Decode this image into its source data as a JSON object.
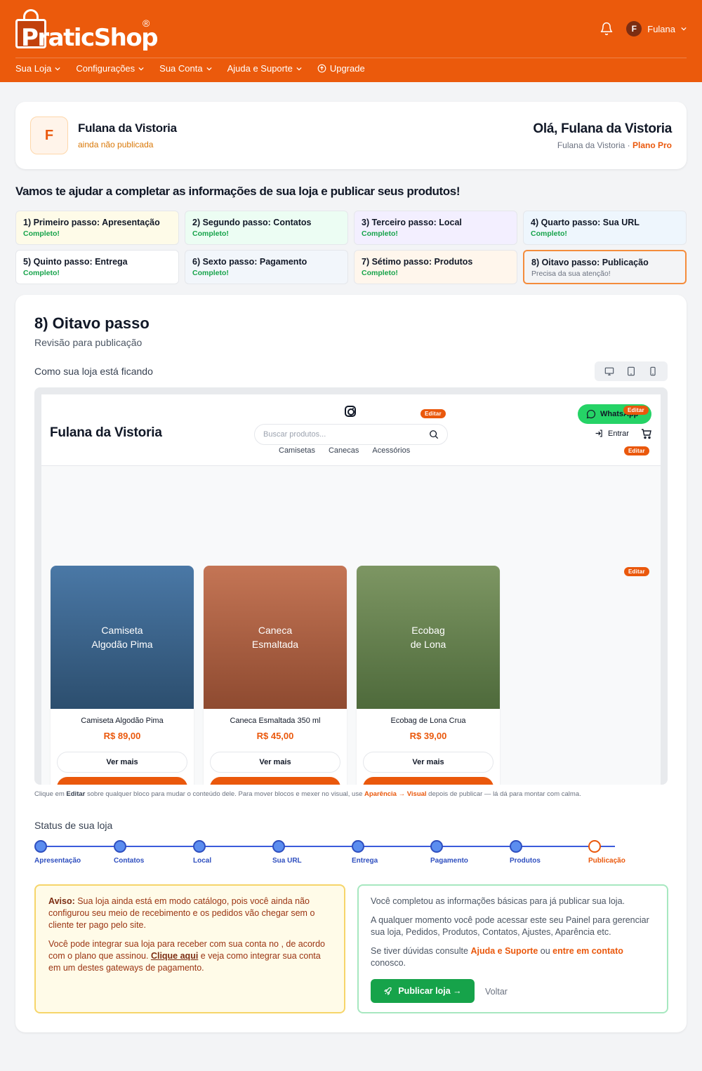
{
  "brand": {
    "name": "PraticShop",
    "reg": "®",
    "color": "#eb5a0c"
  },
  "header": {
    "user": {
      "initial": "F",
      "name": "Fulana"
    },
    "nav": [
      "Sua Loja",
      "Configurações",
      "Sua Conta",
      "Ajuda e Suporte",
      "Upgrade"
    ]
  },
  "profile": {
    "initial": "F",
    "name": "Fulana da Vistoria",
    "status": "ainda não publicada",
    "greeting": "Olá, Fulana da Vistoria",
    "subtitle": "Fulana da Vistoria · ",
    "plan": "Plano Pro"
  },
  "help_title": "Vamos te ajudar a completar as informações de sua loja e publicar seus produtos!",
  "steps": [
    {
      "title": "1) Primeiro passo: Apresentação",
      "status": "Completo!"
    },
    {
      "title": "2) Segundo passo: Contatos",
      "status": "Completo!"
    },
    {
      "title": "3) Terceiro passo: Local",
      "status": "Completo!"
    },
    {
      "title": "4) Quarto passo: Sua URL",
      "status": "Completo!"
    },
    {
      "title": "5) Quinto passo: Entrega",
      "status": "Completo!"
    },
    {
      "title": "6) Sexto passo: Pagamento",
      "status": "Completo!"
    },
    {
      "title": "7) Sétimo passo: Produtos",
      "status": "Completo!"
    },
    {
      "title": "8) Oitavo passo: Publicação",
      "status": "Precisa da sua atenção!"
    }
  ],
  "main": {
    "title": "8) Oitavo passo",
    "subtitle": "Revisão para publicação",
    "preview_label": "Como sua loja está ficando"
  },
  "preview": {
    "store_name": "Fulana da Vistoria",
    "search_placeholder": "Buscar produtos...",
    "categories": [
      "Camisetas",
      "Canecas",
      "Acessórios"
    ],
    "whatsapp": "WhatsApp",
    "login": "Entrar",
    "edit_label": "Editar",
    "products": [
      {
        "img_line1": "Camiseta",
        "img_line2": "Algodão Pima",
        "name": "Camiseta Algodão Pima",
        "price": "R$ 89,00",
        "button": "Ver mais",
        "color_top": "#4a78a6",
        "color_bottom": "#2c4e6e"
      },
      {
        "img_line1": "Caneca",
        "img_line2": "Esmaltada",
        "name": "Caneca Esmaltada 350 ml",
        "price": "R$ 45,00",
        "button": "Ver mais",
        "color_top": "#c47555",
        "color_bottom": "#8e4a30"
      },
      {
        "img_line1": "Ecobag",
        "img_line2": "de Lona",
        "name": "Ecobag de Lona Crua",
        "price": "R$ 39,00",
        "button": "Ver mais",
        "color_top": "#7d9663",
        "color_bottom": "#4e6a3b"
      }
    ]
  },
  "note": {
    "pre": "Clique em ",
    "editar": "Editar",
    "mid": " sobre qualquer bloco para mudar o conteúdo dele. Para mover blocos e mexer no visual, use ",
    "path": "Aparência → Visual",
    "post": " depois de publicar — lá dá para montar com calma."
  },
  "status": {
    "title": "Status de sua loja",
    "steps": [
      "Apresentação",
      "Contatos",
      "Local",
      "Sua URL",
      "Entrega",
      "Pagamento",
      "Produtos",
      "Publicação"
    ]
  },
  "warning": {
    "label": "Aviso:",
    "text1": " Sua loja ainda está em modo catálogo, pois você ainda não configurou seu meio de recebimento e os pedidos vão chegar sem o cliente ter pago pelo site.",
    "text2a": "Você pode integrar sua loja para receber com sua conta no , de acordo com o plano que assinou. ",
    "link": "Clique aqui",
    "text2b": " e veja como integrar sua conta em um destes gateways de pagamento."
  },
  "publish": {
    "p1": "Você completou as informações básicas para já publicar sua loja.",
    "p2": "A qualquer momento você pode acessar este seu Painel para gerenciar sua loja, Pedidos, Produtos, Contatos, Ajustes, Aparência etc.",
    "p3a": "Se tiver dúvidas consulte ",
    "p3_link1": "Ajuda e Suporte",
    "p3b": " ou ",
    "p3_link2": "entre em contato",
    "p3c": " conosco.",
    "button": "Publicar loja →",
    "back": "Voltar"
  }
}
